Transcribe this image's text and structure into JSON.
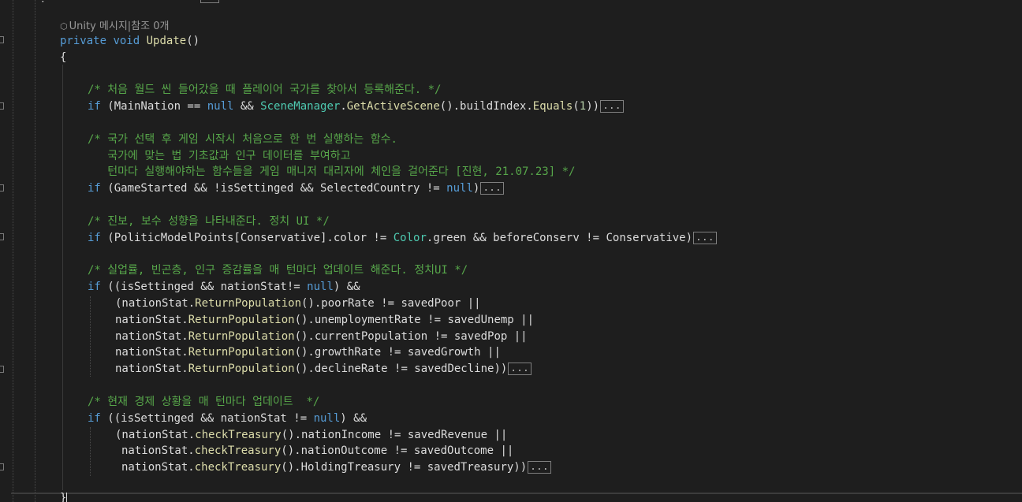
{
  "codelens": {
    "icon": "unity-cube-icon",
    "text": "Unity 메시지|참조 0개"
  },
  "colors": {
    "background": "#1e1e1e",
    "keyword": "#569cd6",
    "type": "#4ec9b0",
    "method": "#dcdcaa",
    "comment": "#57a64a",
    "number": "#b5cea8",
    "text": "#dcdcdc"
  },
  "code": {
    "signature": {
      "kw1": "private",
      "kw2": "void",
      "name": "Update",
      "parens": "()"
    },
    "open_brace": "{",
    "close_brace": "}",
    "block1": {
      "comment": "/* 처음 월드 씬 들어갔을 때 플레이어 국가를 찾아서 등록해준다. */",
      "if": "if",
      "p1": " (MainNation == ",
      "null": "null",
      "p2": " && ",
      "scene_manager": "SceneManager",
      "p3": ".",
      "get_active_scene": "GetActiveScene",
      "p4": "().buildIndex.",
      "equals": "Equals",
      "p5": "(",
      "one": "1",
      "p6": "))",
      "collapsed": "..."
    },
    "block2": {
      "comment1": "/* 국가 선택 후 게임 시작시 처음으로 한 번 실행하는 함수.",
      "comment2": "   국가에 맞는 법 기초값과 인구 데이터를 부여하고",
      "comment3": "   턴마다 실행해야하는 함수들을 게임 매니저 대리자에 체인을 걸어준다 [진현, 21.07.23] */",
      "if": "if",
      "p1": " (GameStarted && !isSettinged && SelectedCountry != ",
      "null": "null",
      "p2": ")",
      "collapsed": "..."
    },
    "block3": {
      "comment": "/* 진보, 보수 성향을 나타내준다. 정치 UI */",
      "if": "if",
      "p1": " (PoliticModelPoints[Conservative].color != ",
      "color_type": "Color",
      "p2": ".green && beforeConserv != Conservative)",
      "collapsed": "..."
    },
    "block4": {
      "comment": "/* 실업률, 빈곤층, 인구 증감률을 매 턴마다 업데이트 해준다. 정치UI */",
      "if": "if",
      "p1": " ((isSettinged && nationStat!= ",
      "null": "null",
      "p2": ") &&",
      "method": "ReturnPopulation",
      "rows": [
        {
          "pre": "(nationStat.",
          "post": "().poorRate != savedPoor ||"
        },
        {
          "pre": "nationStat.",
          "post": "().unemploymentRate != savedUnemp ||"
        },
        {
          "pre": "nationStat.",
          "post": "().currentPopulation != savedPop ||"
        },
        {
          "pre": "nationStat.",
          "post": "().growthRate != savedGrowth ||"
        },
        {
          "pre": "nationStat.",
          "post": "().declineRate != savedDecline))"
        }
      ],
      "collapsed": "..."
    },
    "block5": {
      "comment": "/* 현재 경제 상황을 매 턴마다 업데이트  */",
      "if": "if",
      "p1": " ((isSettinged && nationStat != ",
      "null": "null",
      "p2": ") &&",
      "method": "checkTreasury",
      "rows": [
        {
          "pre": "(nationStat.",
          "post": "().nationIncome != savedRevenue ||"
        },
        {
          "pre": "nationStat.",
          "post": "().nationOutcome != savedOutcome ||"
        },
        {
          "pre": "nationStat.",
          "post": "().HoldingTreasury != savedTreasury))"
        }
      ],
      "collapsed": "..."
    }
  }
}
